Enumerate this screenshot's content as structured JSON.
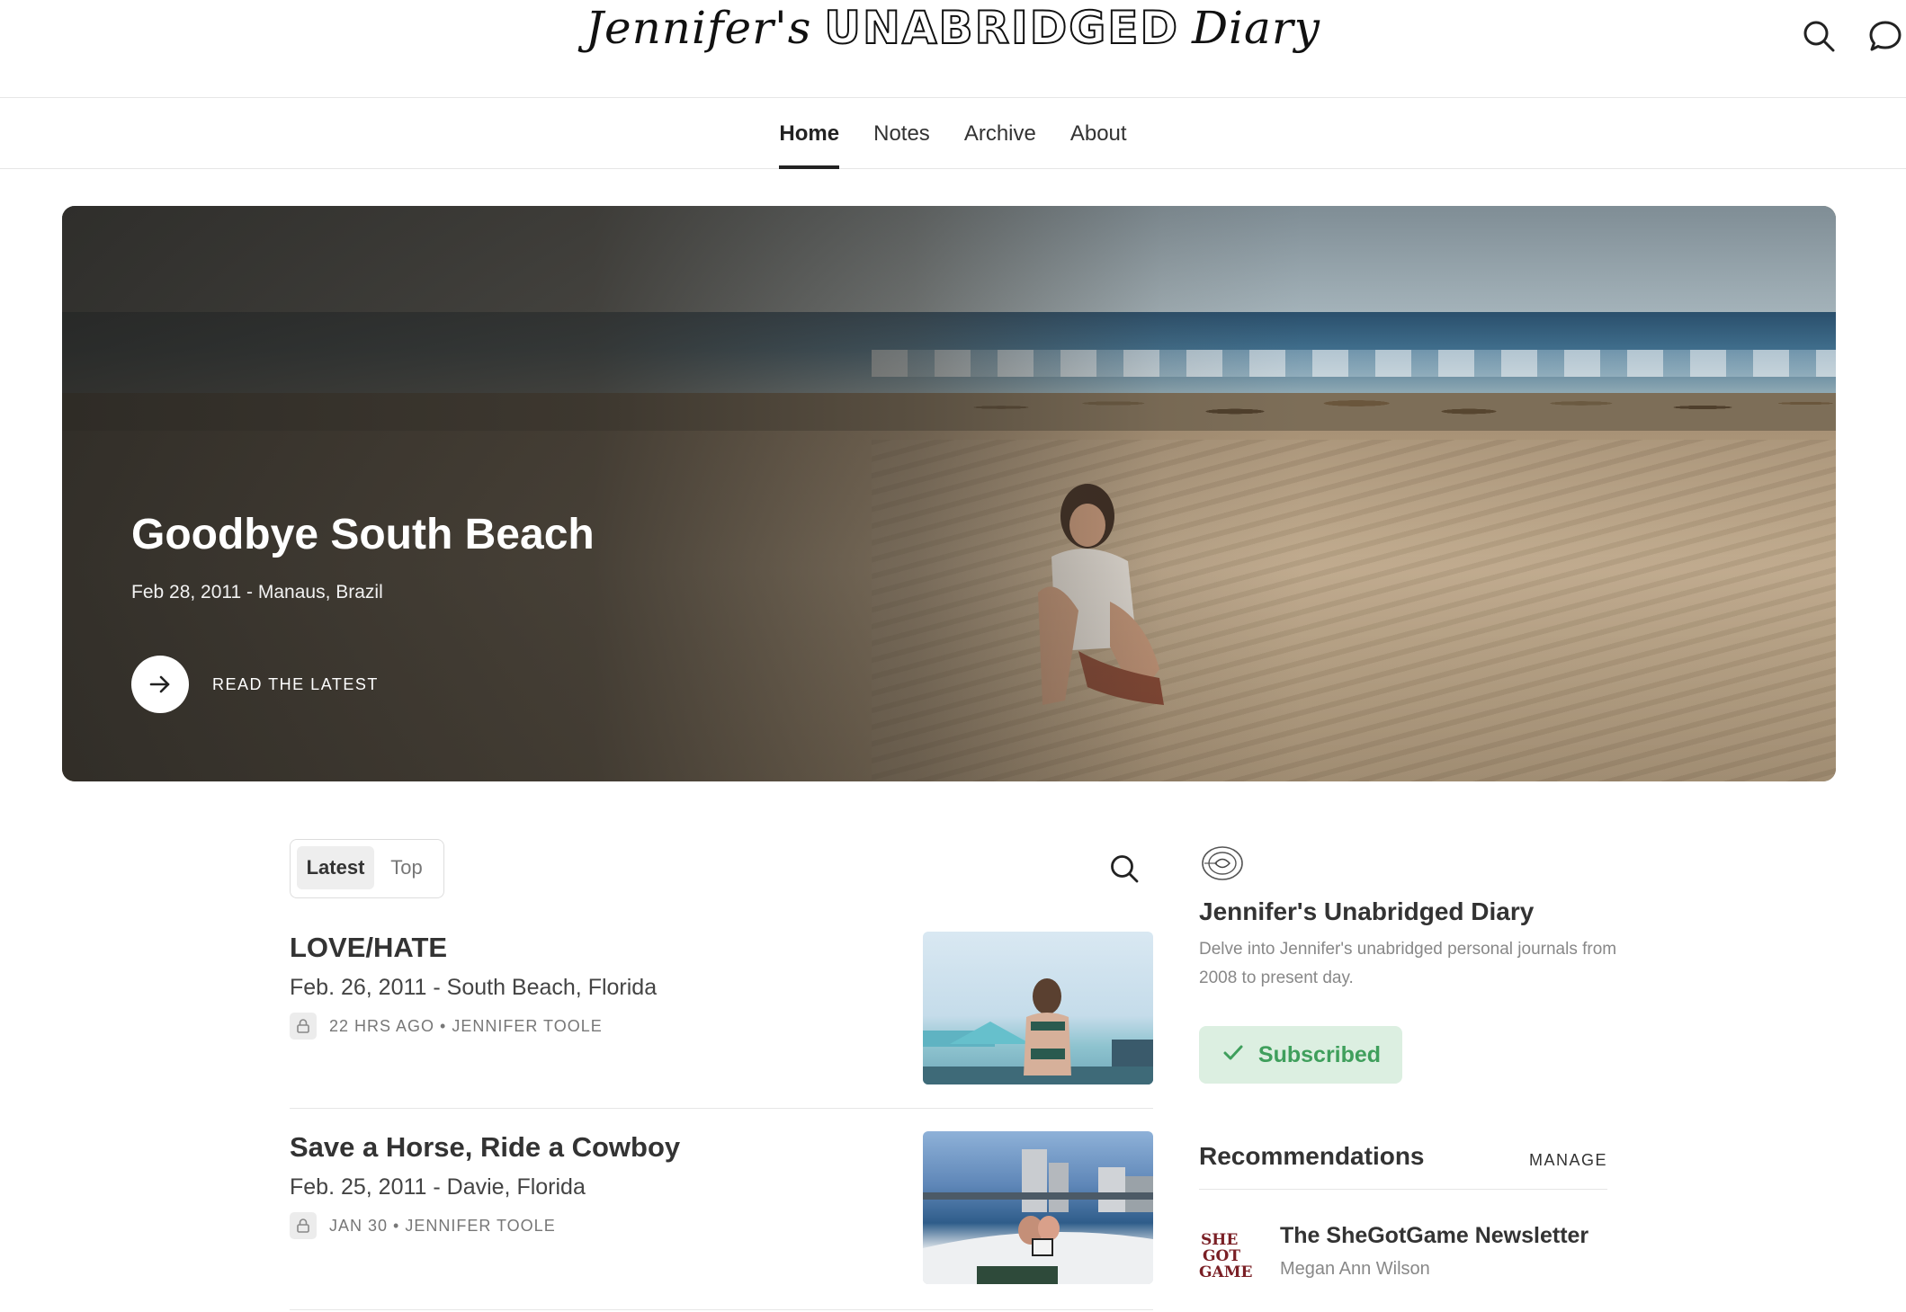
{
  "header": {
    "logo_part1": "Jennifer's",
    "logo_part2": "UNABRIDGED",
    "logo_part3": "Diary",
    "icons": [
      "search-icon",
      "chat-bubble-icon"
    ]
  },
  "nav": {
    "items": [
      {
        "label": "Home",
        "active": true
      },
      {
        "label": "Notes",
        "active": false
      },
      {
        "label": "Archive",
        "active": false
      },
      {
        "label": "About",
        "active": false
      }
    ]
  },
  "hero": {
    "title": "Goodbye South Beach",
    "date": "Feb 28, 2011 - Manaus, Brazil",
    "cta_label": "READ THE LATEST",
    "cta_icon": "arrow-right-icon"
  },
  "posts_tabs": {
    "latest": "Latest",
    "top": "Top",
    "selected": "Latest"
  },
  "posts": [
    {
      "title": "LOVE/HATE",
      "subtitle": "Feb. 26, 2011 - South Beach, Florida",
      "meta": "22 HRS AGO • JENNIFER TOOLE",
      "locked": true
    },
    {
      "title": "Save a Horse, Ride a Cowboy",
      "subtitle": "Feb. 25, 2011 - Davie, Florida",
      "meta": "JAN 30 • JENNIFER TOOLE",
      "locked": true
    }
  ],
  "sidebar": {
    "pub_title": "Jennifer's Unabridged Diary",
    "pub_description": "Delve into Jennifer's unabridged personal journals from 2008 to present day.",
    "subscribe_state": "Subscribed",
    "subscribe_color": "#3f9f5c",
    "recommendations_title": "Recommendations",
    "manage_label": "MANAGE",
    "recommendations": [
      {
        "name": "The SheGotGame Newsletter",
        "author": "Megan Ann Wilson",
        "logo_text": "SHE GOT GAME"
      }
    ]
  }
}
